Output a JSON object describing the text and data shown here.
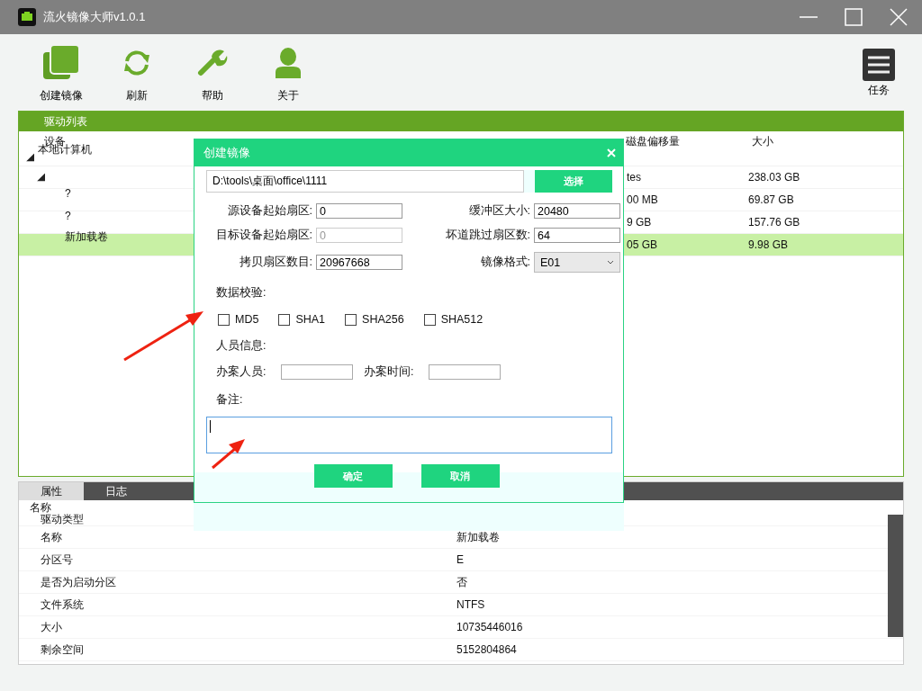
{
  "window": {
    "title": "流火镜像大师v1.0.1"
  },
  "toolbar": [
    {
      "kind": "create",
      "label": "创建镜像"
    },
    {
      "kind": "refresh",
      "label": "刷新"
    },
    {
      "kind": "help",
      "label": "帮助"
    },
    {
      "kind": "about",
      "label": "关于"
    }
  ],
  "task_button": {
    "label": "任务"
  },
  "drive_list": {
    "title": "驱动列表",
    "columns": [
      "设备",
      "磁盘偏移量",
      "大小"
    ],
    "rows": [
      {
        "name": "本地计算机",
        "expanded": true,
        "selected": false,
        "children": [
          {
            "expanded": true,
            "selected": false,
            "offset": "tes",
            "size": "238.03 GB",
            "children": [
              {
                "name": "?",
                "selected": false,
                "offset": "00 MB",
                "size": "69.87 GB"
              },
              {
                "name": "?",
                "selected": false,
                "offset": "9 GB",
                "size": "157.76 GB"
              },
              {
                "name": "新加载卷",
                "selected": true,
                "offset": "05 GB",
                "size": "9.98 GB"
              }
            ]
          }
        ]
      }
    ]
  },
  "bottom_tabs": [
    {
      "label": "属性",
      "selected": true
    },
    {
      "label": "日志",
      "selected": false
    }
  ],
  "properties": {
    "group": "名称",
    "rows": [
      {
        "name": "驱动类型"
      },
      {
        "name": "名称",
        "value": "新加载卷"
      },
      {
        "name": "分区号",
        "value": "E"
      },
      {
        "name": "是否为启动分区",
        "value": "否"
      },
      {
        "name": "文件系统",
        "value": "NTFS"
      },
      {
        "name": "大小",
        "value": "10735446016"
      },
      {
        "name": "剩余空间",
        "value": "5152804864"
      }
    ]
  },
  "dialog": {
    "title": "创建镜像",
    "path": "D:\\tools\\桌面\\office\\1111",
    "choose_button": "选择",
    "fields": [
      {
        "label": "源设备起始扇区:",
        "value": "0",
        "disabled": false,
        "kind": "input"
      },
      {
        "label": "缓冲区大小:",
        "value": "20480",
        "disabled": false,
        "kind": "input"
      },
      {
        "label": "目标设备起始扇区:",
        "value": "0",
        "disabled": true,
        "kind": "input"
      },
      {
        "label": "坏道跳过扇区数:",
        "value": "64",
        "disabled": false,
        "kind": "input"
      },
      {
        "label": "拷贝扇区数目:",
        "value": "20967668",
        "disabled": false,
        "kind": "input"
      },
      {
        "label": "镜像格式:",
        "value": "E01",
        "disabled": false,
        "kind": "select"
      }
    ],
    "verify_label": "数据校验:",
    "checks": [
      {
        "label": "MD5",
        "checked": false
      },
      {
        "label": "SHA1",
        "checked": false
      },
      {
        "label": "SHA256",
        "checked": false
      },
      {
        "label": "SHA512",
        "checked": false
      }
    ],
    "person_label": "人员信息:",
    "person_fields": [
      {
        "label": "办案人员:"
      },
      {
        "label": "办案时间:"
      }
    ],
    "note_label": "备注:",
    "buttons": [
      "确定",
      "取消"
    ]
  }
}
